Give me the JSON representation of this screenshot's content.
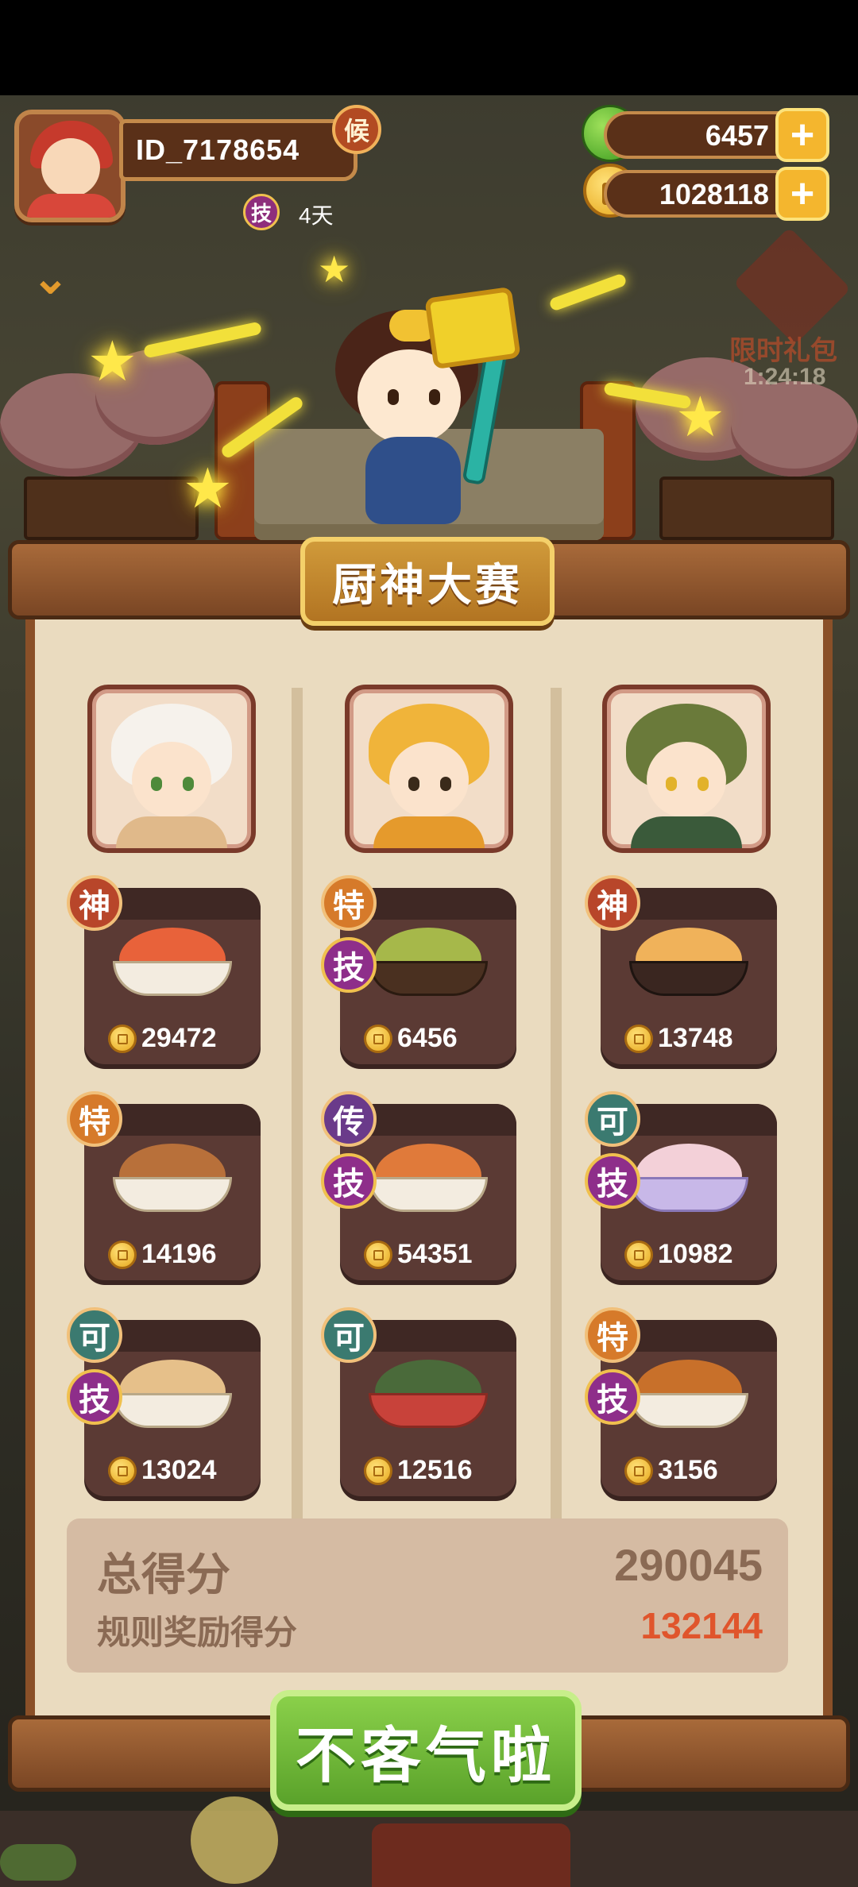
{
  "player": {
    "id": "ID_7178654",
    "title_badge": "候",
    "skill_badge": "技",
    "days": "4天"
  },
  "resources": {
    "apples": "6457",
    "coins": "1028118",
    "plus": "+"
  },
  "event": {
    "gift_label": "限时礼包",
    "gift_timer": "1:24:18"
  },
  "contest": {
    "title": "厨神大赛",
    "dishes": [
      {
        "grade": "神",
        "skill": "",
        "score": "29472"
      },
      {
        "grade": "特",
        "skill": "技",
        "score": "6456"
      },
      {
        "grade": "神",
        "skill": "",
        "score": "13748"
      },
      {
        "grade": "特",
        "skill": "",
        "score": "14196"
      },
      {
        "grade": "传",
        "skill": "技",
        "score": "54351"
      },
      {
        "grade": "可",
        "skill": "技",
        "score": "10982"
      },
      {
        "grade": "可",
        "skill": "技",
        "score": "13024"
      },
      {
        "grade": "可",
        "skill": "",
        "score": "12516"
      },
      {
        "grade": "特",
        "skill": "技",
        "score": "3156"
      }
    ],
    "total_label": "总得分",
    "total_value": "290045",
    "bonus_label": "规则奖励得分",
    "bonus_value": "132144"
  },
  "confirm_button": "不客气啦"
}
